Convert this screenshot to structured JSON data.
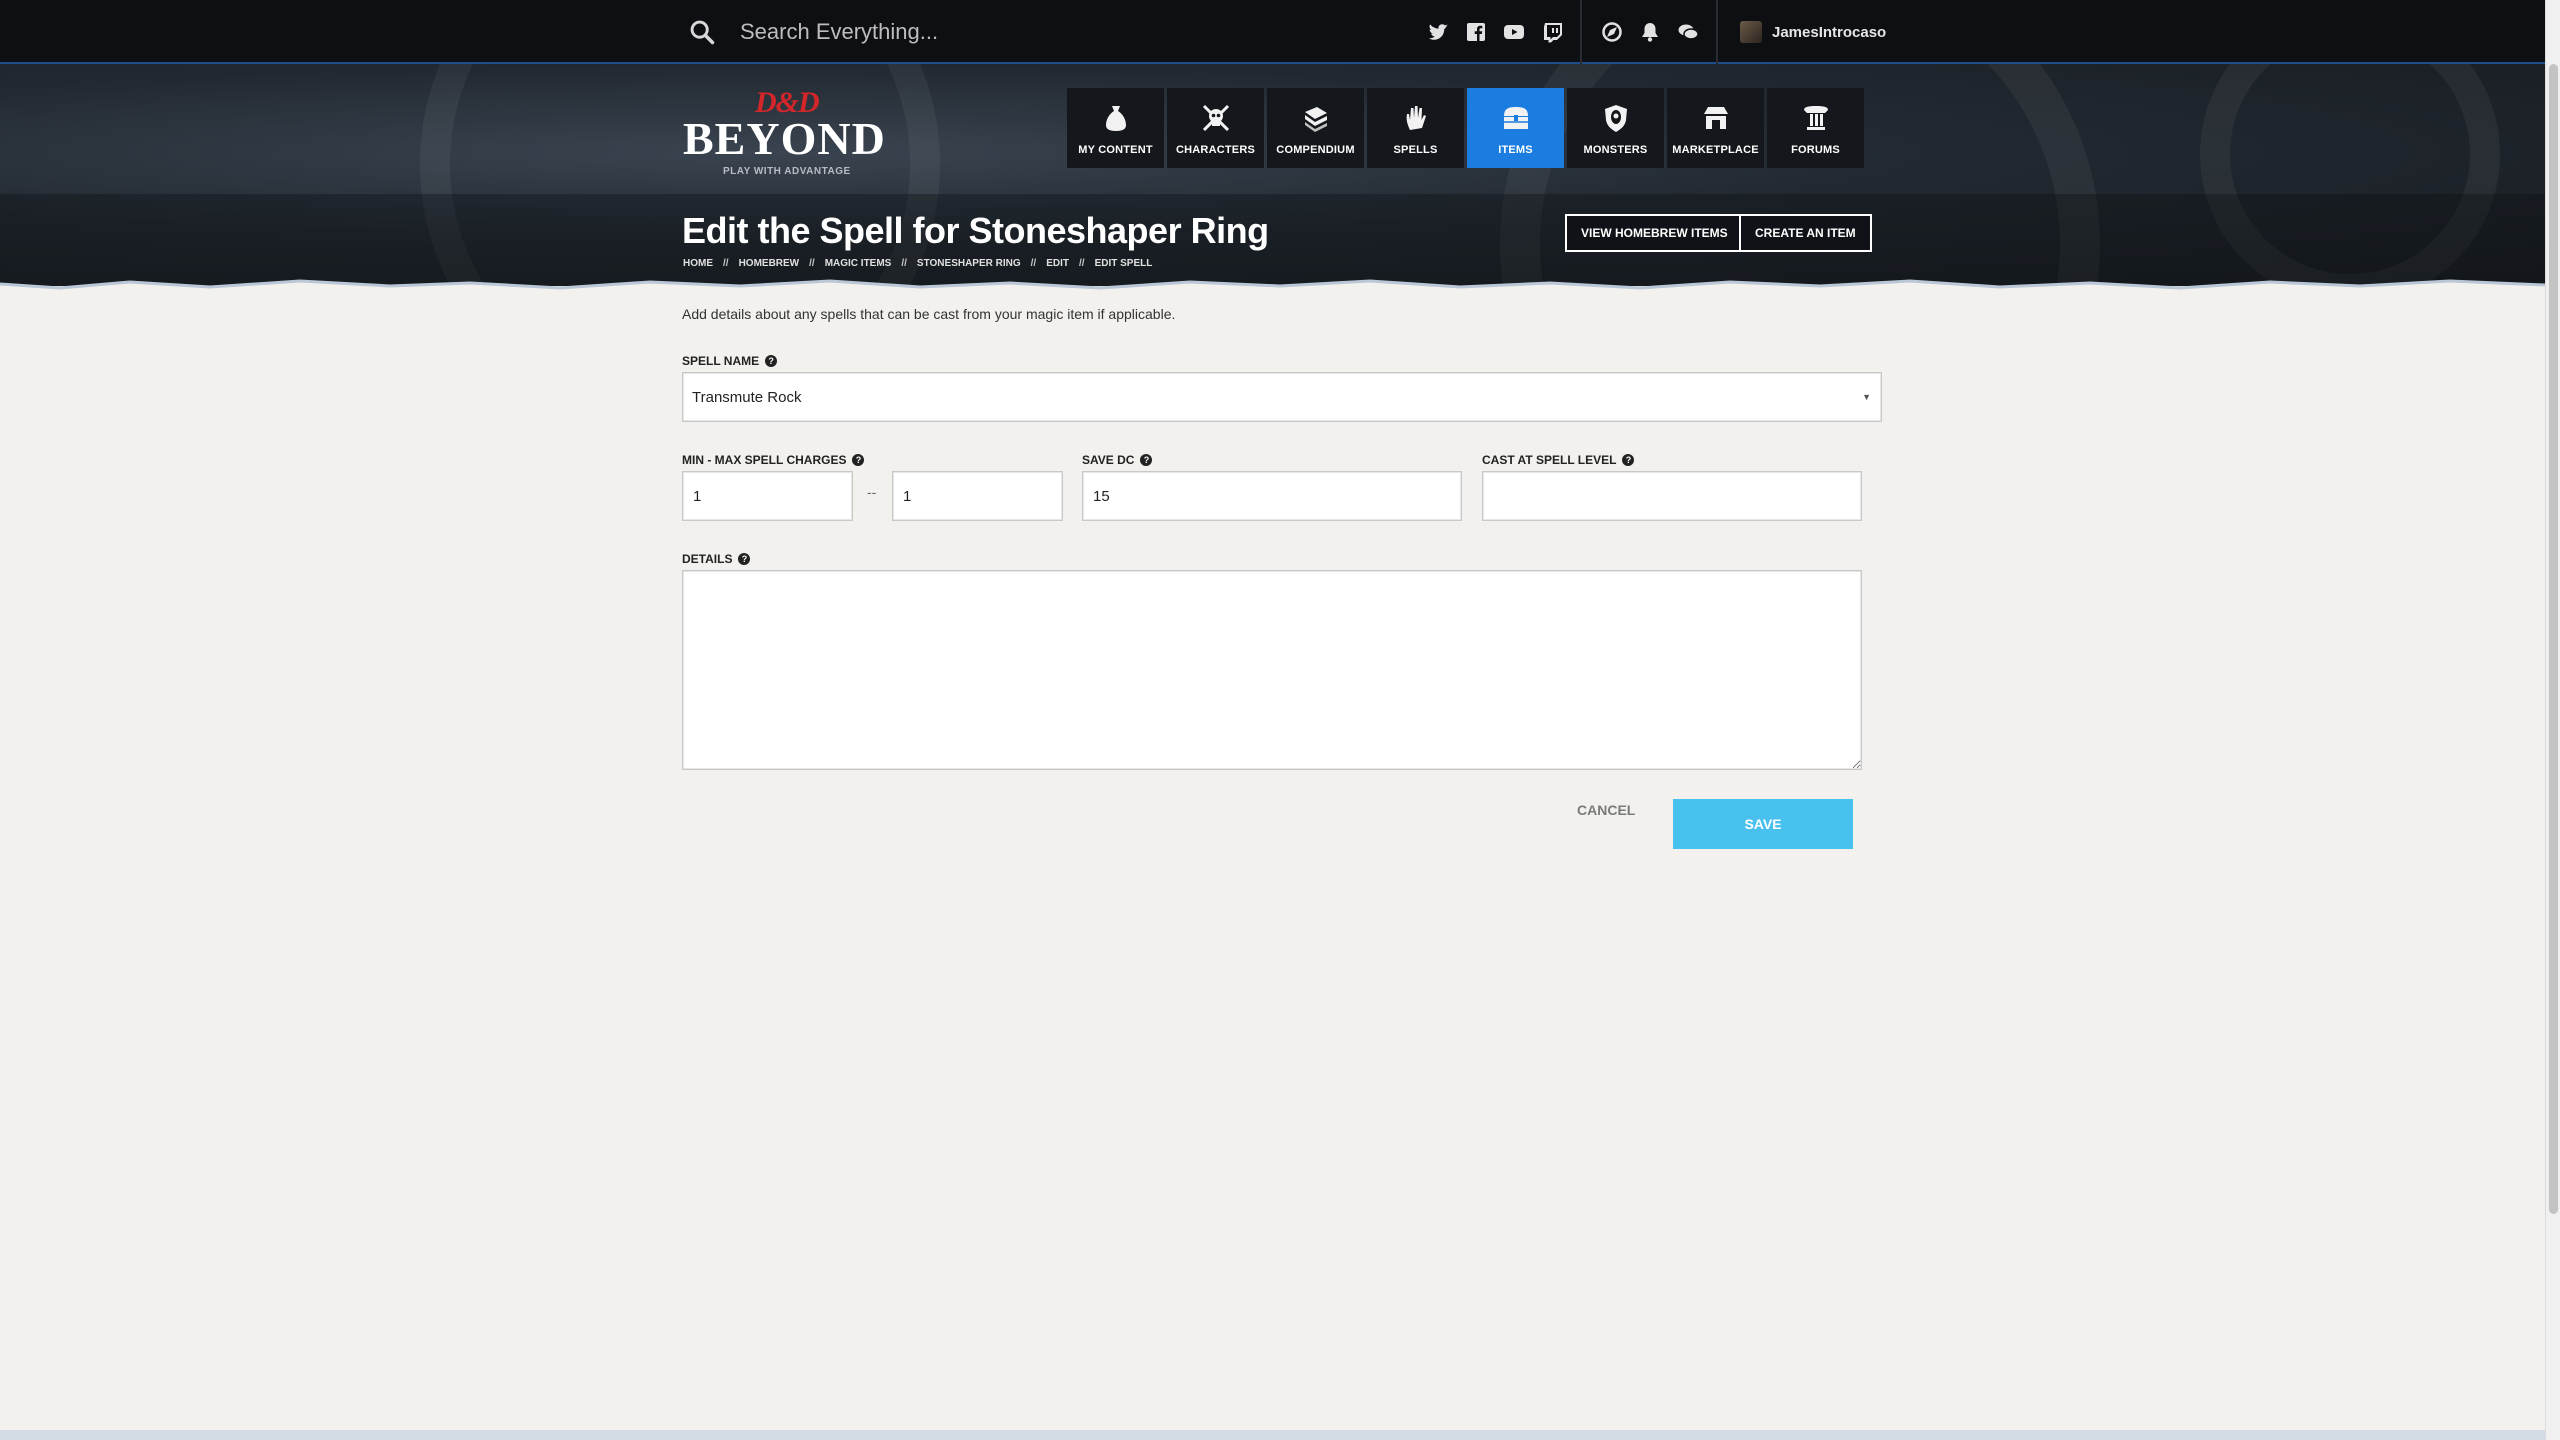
{
  "topbar": {
    "search_placeholder": "Search Everything...",
    "icons": [
      "search-icon",
      "twitter-icon",
      "facebook-icon",
      "youtube-icon",
      "twitch-icon",
      "compass-icon",
      "bell-icon",
      "chat-icon"
    ],
    "username": "JamesIntrocaso"
  },
  "logo": {
    "top": "D&D",
    "main": "BEYOND",
    "tagline": "PLAY WITH ADVANTAGE"
  },
  "nav": [
    {
      "label": "MY CONTENT",
      "icon": "bag-icon"
    },
    {
      "label": "CHARACTERS",
      "icon": "skull-swords-icon"
    },
    {
      "label": "COMPENDIUM",
      "icon": "books-icon"
    },
    {
      "label": "SPELLS",
      "icon": "hand-spell-icon"
    },
    {
      "label": "ITEMS",
      "icon": "chest-icon",
      "active": true
    },
    {
      "label": "MONSTERS",
      "icon": "monster-shield-icon"
    },
    {
      "label": "MARKETPLACE",
      "icon": "store-icon"
    },
    {
      "label": "FORUMS",
      "icon": "pillar-icon"
    }
  ],
  "header": {
    "title": "Edit the Spell for Stoneshaper Ring",
    "breadcrumb": [
      "HOME",
      "HOMEBREW",
      "MAGIC ITEMS",
      "STONESHAPER RING",
      "EDIT",
      "EDIT SPELL"
    ],
    "breadcrumb_divider": "//",
    "view_homebrew_label": "VIEW HOMEBREW ITEMS",
    "create_item_label": "CREATE AN ITEM"
  },
  "form": {
    "intro": "Add details about any spells that can be cast from your magic item if applicable.",
    "spell_name_label": "SPELL NAME",
    "spell_name_value": "Transmute Rock",
    "charges_label": "MIN - MAX SPELL CHARGES",
    "charges_min": "1",
    "charges_separator": "--",
    "charges_max": "1",
    "save_dc_label": "SAVE DC",
    "save_dc_value": "15",
    "cast_level_label": "CAST AT SPELL LEVEL",
    "cast_level_value": "",
    "details_label": "DETAILS",
    "details_value": "",
    "help_glyph": "?",
    "cancel_label": "CANCEL",
    "save_label": "SAVE"
  },
  "colors": {
    "accent": "#1b7de0",
    "save": "#48c1ef",
    "brand_red": "#d2262a"
  }
}
